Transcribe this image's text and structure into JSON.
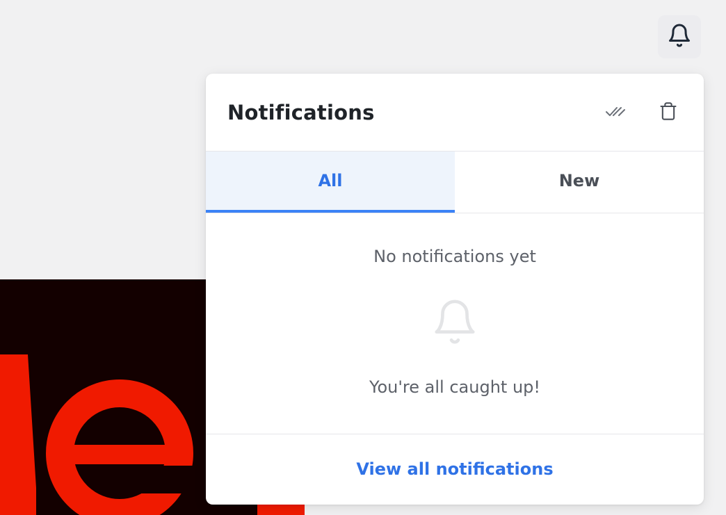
{
  "notifications_panel": {
    "title": "Notifications",
    "tabs": [
      {
        "label": "All",
        "active": true
      },
      {
        "label": "New",
        "active": false
      }
    ],
    "empty_state": {
      "title": "No notifications yet",
      "subtitle": "You're all caught up!"
    },
    "footer_link": "View all notifications",
    "actions": {
      "mark_all_read_icon": "double-check-icon",
      "clear_all_icon": "trash-icon"
    }
  },
  "top_bar": {
    "bell_icon": "bell-icon"
  },
  "colors": {
    "accent": "#3b82f6",
    "accent_text": "#2f72e6",
    "page_background": "#f1f1f2",
    "hero_background": "#130000",
    "hero_glyph": "#f01a00"
  }
}
